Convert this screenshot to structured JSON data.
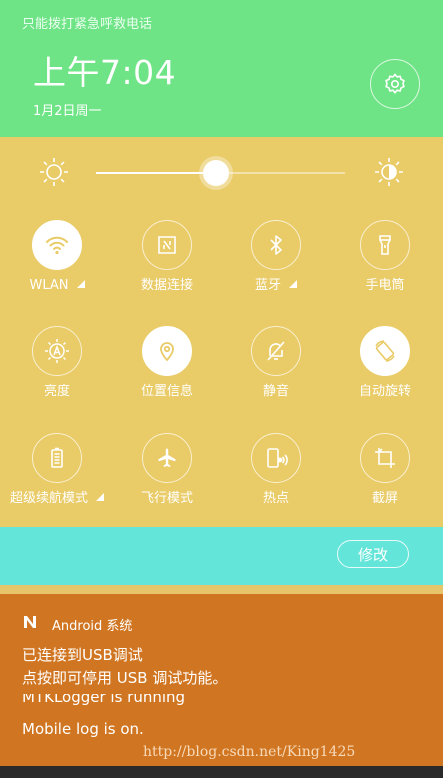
{
  "status": {
    "emergency_text": "只能拨打紧急呼救电话"
  },
  "header": {
    "time": "上午7:04",
    "date": "1月2日周一"
  },
  "brightness": {
    "level": 0.48
  },
  "tiles": [
    {
      "label": "WLAN",
      "icon": "wifi-icon",
      "active": true,
      "expand": true
    },
    {
      "label": "数据连接",
      "icon": "mobile-data-icon",
      "active": false,
      "expand": false
    },
    {
      "label": "蓝牙",
      "icon": "bluetooth-icon",
      "active": false,
      "expand": true
    },
    {
      "label": "手电筒",
      "icon": "flashlight-icon",
      "active": false,
      "expand": false
    },
    {
      "label": "亮度",
      "icon": "auto-brightness-icon",
      "active": false,
      "expand": false
    },
    {
      "label": "位置信息",
      "icon": "location-icon",
      "active": true,
      "expand": false
    },
    {
      "label": "静音",
      "icon": "mute-icon",
      "active": false,
      "expand": false
    },
    {
      "label": "自动旋转",
      "icon": "auto-rotate-icon",
      "active": true,
      "expand": false
    },
    {
      "label": "超级续航模式",
      "icon": "battery-saver-icon",
      "active": false,
      "expand": true
    },
    {
      "label": "飞行模式",
      "icon": "airplane-icon",
      "active": false,
      "expand": false
    },
    {
      "label": "热点",
      "icon": "hotspot-icon",
      "active": false,
      "expand": false
    },
    {
      "label": "截屏",
      "icon": "screenshot-icon",
      "active": false,
      "expand": false
    }
  ],
  "edit": {
    "label": "修改"
  },
  "notification": {
    "app": "Android 系统",
    "title": "已连接到USB调试",
    "text": "点按即可停用 USB 调试功能。",
    "partial_line": "MTKLogger is running",
    "log_status": "Mobile log is on."
  },
  "watermark": "http://blog.csdn.net/King1425",
  "colors": {
    "header": "#6fe486",
    "panel": "#e9cb67",
    "edit_bar": "#64e5d9",
    "notification": "#d07622"
  }
}
